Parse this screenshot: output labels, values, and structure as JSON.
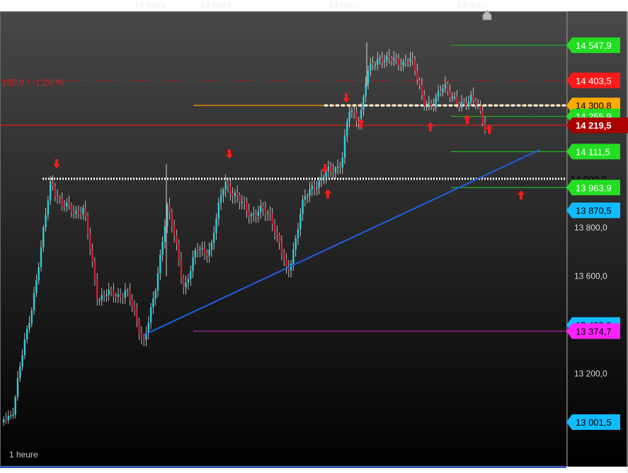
{
  "chart_data": {
    "type": "candlestick",
    "timeframe_label": "1 heure",
    "change_label": "180,9 / -1,26 %",
    "xaxis_labels": [
      "14 mars",
      "14 mars",
      "14 mars",
      "14 mars"
    ],
    "yaxis_ticks": [
      {
        "value": 13800,
        "label": "13 800,0"
      },
      {
        "value": 13600,
        "label": "13 600,0"
      },
      {
        "value": 13400,
        "label": "13 400,0"
      },
      {
        "value": 13200,
        "label": "13 200,0"
      },
      {
        "value": 13000,
        "label": "13 000,0"
      }
    ],
    "price_levels": [
      {
        "value": 14547.9,
        "label": "14 547,9",
        "bg": "#22dd22",
        "fg": "#ffffff",
        "line_color": "#22aa22",
        "style": "solid-short"
      },
      {
        "value": 14403.5,
        "label": "14 403,5",
        "bg": "#ff1a1a",
        "fg": "#ffffff",
        "line_color": "#cc2222",
        "style": "dotted"
      },
      {
        "value": 14300.8,
        "label": "14 300,8",
        "bg": "#ffaa00",
        "fg": "#000000",
        "line_color": "#e08a00",
        "style": "solid"
      },
      {
        "value": 14255.9,
        "label": "14 255,9",
        "bg": "#22dd22",
        "fg": "#ffffff",
        "line_color": "#22aa22",
        "style": "solid-short"
      },
      {
        "value": 14219.5,
        "label": "14 219,5",
        "bg": "#aa0000",
        "fg": "#ffffff",
        "line_color": "#cc2222",
        "style": "solid",
        "bold": true
      },
      {
        "value": 14111.5,
        "label": "14 111,5",
        "bg": "#22dd22",
        "fg": "#ffffff",
        "line_color": "#22aa22",
        "style": "solid-short"
      },
      {
        "value": 14000.0,
        "label": "14 000,0",
        "bg": "none",
        "fg": "#000000",
        "line_color": "#ffffff",
        "style": "dotted-white"
      },
      {
        "value": 13963.9,
        "label": "13 963,9",
        "bg": "#22dd22",
        "fg": "#ffffff",
        "line_color": "#22aa22",
        "style": "solid-short"
      },
      {
        "value": 13870.5,
        "label": "13 870,5",
        "bg": "#11bbff",
        "fg": "#000000",
        "line_color": "none",
        "style": "none"
      },
      {
        "value": 13400.0,
        "label": "13 400,0",
        "bg": "#11bbff",
        "fg": "#000000",
        "line_color": "none",
        "style": "none"
      },
      {
        "value": 13374.7,
        "label": "13 374,7",
        "bg": "#ff22ff",
        "fg": "#000000",
        "line_color": "#aa22aa",
        "style": "solid"
      },
      {
        "value": 13001.5,
        "label": "13 001,5",
        "bg": "#11bbff",
        "fg": "#000000",
        "line_color": "none",
        "style": "none"
      }
    ],
    "colors": {
      "up": "#33ccdd",
      "down": "#cc2233",
      "trendline": "#1e5fe0",
      "arrow": "#ff1a1a"
    }
  }
}
